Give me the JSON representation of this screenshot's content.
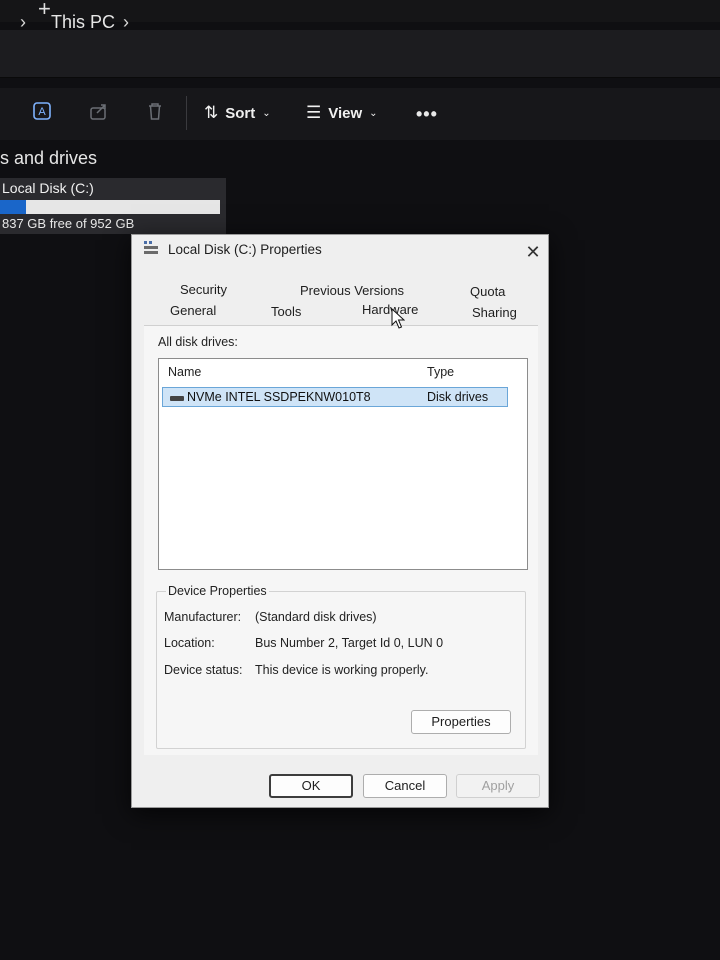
{
  "explorer": {
    "new_tab": "+",
    "breadcrumb": "This PC",
    "toolbar": {
      "sort_label": "Sort",
      "view_label": "View",
      "more": "•••"
    },
    "section_title": "s and drives",
    "drive": {
      "name": "Local Disk (C:)",
      "free_text": "837 GB free of 952 GB",
      "used_fraction": 0.12
    }
  },
  "dialog": {
    "title": "Local Disk (C:) Properties",
    "close": "✕",
    "tabs_row1": [
      "Security",
      "Previous Versions",
      "Quota"
    ],
    "tabs_row2": [
      "General",
      "Tools",
      "Hardware",
      "Sharing"
    ],
    "active_tab": "Hardware",
    "all_disk_drives_label": "All disk drives:",
    "columns": [
      "Name",
      "Type"
    ],
    "drives": [
      {
        "name": "NVMe INTEL SSDPEKNW010T8",
        "type": "Disk drives"
      }
    ],
    "device_properties": {
      "title": "Device Properties",
      "manufacturer_label": "Manufacturer:",
      "manufacturer_value": "(Standard disk drives)",
      "location_label": "Location:",
      "location_value": "Bus Number 2, Target Id 0, LUN 0",
      "status_label": "Device status:",
      "status_value": "This device is working properly.",
      "properties_button": "Properties"
    },
    "buttons": {
      "ok": "OK",
      "cancel": "Cancel",
      "apply": "Apply"
    }
  },
  "colors": {
    "selection": "#cfe4f7",
    "drive_bar": "#1a66c9"
  }
}
